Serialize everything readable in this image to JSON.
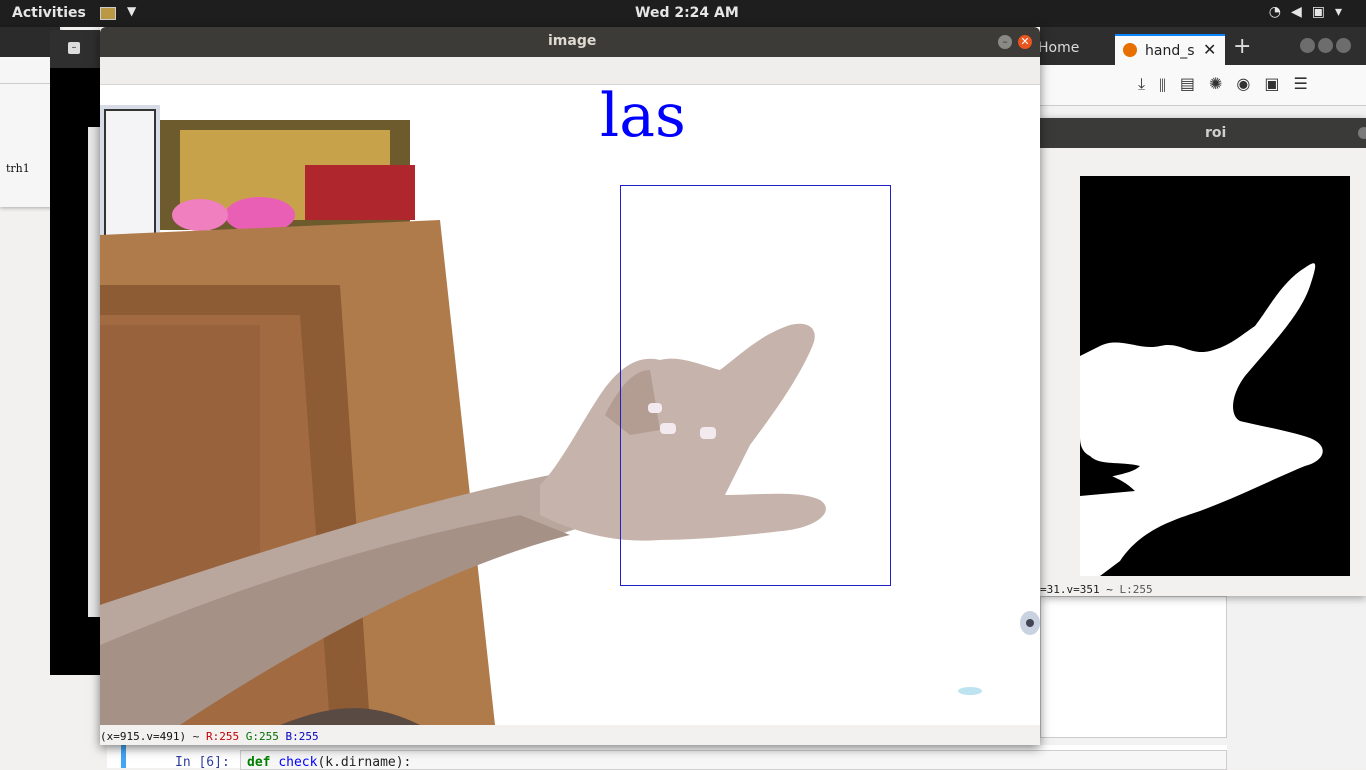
{
  "topbar": {
    "activities": "Activities",
    "clock": "Wed  2:24 AM",
    "tray_icons": [
      "wifi-icon",
      "volume-icon",
      "battery-icon",
      "system-menu-chevron-icon"
    ]
  },
  "firefox": {
    "tab_home": "Home",
    "tab_active": "hand_s",
    "new_tab": "+"
  },
  "left_window": {
    "label": "trh1"
  },
  "roi_window": {
    "title": "roi",
    "status_coords": "=31.v=351",
    "status_sep": "~",
    "status_l": "L:255"
  },
  "image_window": {
    "title": "image",
    "prediction_text": "las",
    "status": {
      "coords": "(x=915.v=491)",
      "sep": "~",
      "r": "R:255",
      "g": "G:255",
      "b": "B:255"
    }
  },
  "jupyter": {
    "prompt": "In [6]:",
    "code_def": "def",
    "code_fn": "check",
    "code_args": "(k.dirname):"
  },
  "colors": {
    "prediction": "#0000ff",
    "roi_box": "#2020c8",
    "close_button": "#e9541f"
  }
}
